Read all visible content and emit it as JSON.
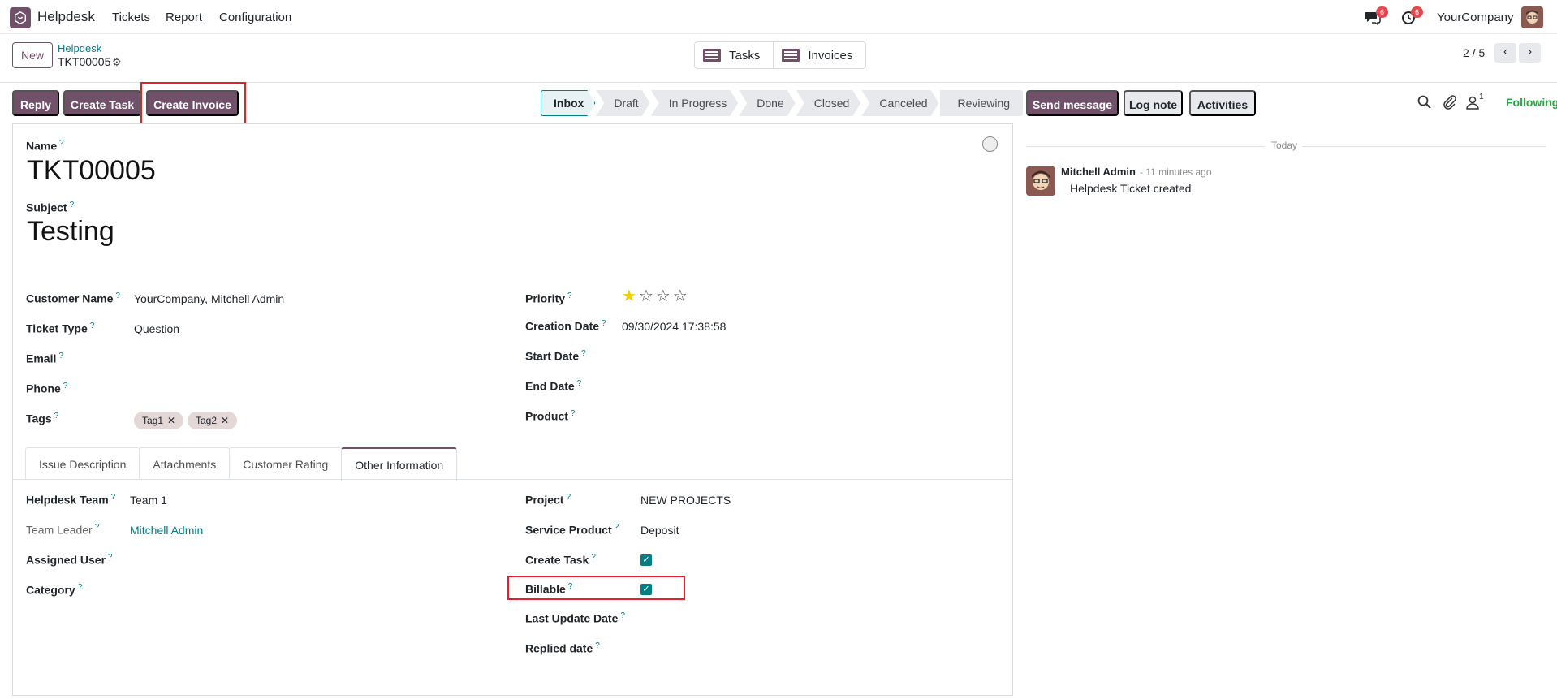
{
  "navbar": {
    "app_name": "Helpdesk",
    "menus": [
      "Tickets",
      "Report",
      "Configuration"
    ],
    "messages_badge": "6",
    "activities_badge": "6",
    "company": "YourCompany"
  },
  "control_panel": {
    "new_label": "New",
    "breadcrumb_parent": "Helpdesk",
    "breadcrumb_current": "TKT00005",
    "smart_buttons": [
      "Tasks",
      "Invoices"
    ],
    "pager": "2 / 5"
  },
  "actions": {
    "reply": "Reply",
    "create_task": "Create Task",
    "create_invoice": "Create Invoice"
  },
  "stages": [
    "Inbox",
    "Draft",
    "In Progress",
    "Done",
    "Closed",
    "Canceled",
    "Reviewing"
  ],
  "active_stage": "Inbox",
  "form": {
    "name_label": "Name",
    "name": "TKT00005",
    "subject_label": "Subject",
    "subject": "Testing",
    "left_fields": [
      {
        "label": "Customer Name",
        "value": "YourCompany, Mitchell Admin"
      },
      {
        "label": "Ticket Type",
        "value": "Question"
      },
      {
        "label": "Email",
        "value": ""
      },
      {
        "label": "Phone",
        "value": ""
      },
      {
        "label": "Tags",
        "value": ""
      }
    ],
    "tags": [
      "Tag1",
      "Tag2"
    ],
    "right_fields": [
      {
        "label": "Priority",
        "value": ""
      },
      {
        "label": "Creation Date",
        "value": "09/30/2024 17:38:58"
      },
      {
        "label": "Start Date",
        "value": ""
      },
      {
        "label": "End Date",
        "value": ""
      },
      {
        "label": "Product",
        "value": ""
      }
    ],
    "priority_stars": 1,
    "priority_max": 4,
    "tabs": [
      "Issue Description",
      "Attachments",
      "Customer Rating",
      "Other Information"
    ],
    "active_tab": "Other Information",
    "other_left": [
      {
        "label": "Helpdesk Team",
        "value": "Team 1"
      },
      {
        "label": "Team Leader",
        "value": "Mitchell Admin"
      },
      {
        "label": "Assigned User",
        "value": ""
      },
      {
        "label": "Category",
        "value": ""
      }
    ],
    "other_right": [
      {
        "label": "Project",
        "value": "NEW PROJECTS"
      },
      {
        "label": "Service Product",
        "value": "Deposit"
      },
      {
        "label": "Create Task",
        "value": ""
      },
      {
        "label": "Billable",
        "value": ""
      },
      {
        "label": "Last Update Date",
        "value": ""
      },
      {
        "label": "Replied date",
        "value": ""
      }
    ],
    "create_task_checked": true,
    "billable_checked": true,
    "help_mark": "?"
  },
  "chatter": {
    "send_message": "Send message",
    "log_note": "Log note",
    "activities": "Activities",
    "followers_count": "1",
    "following": "Following",
    "date_separator": "Today",
    "message": {
      "author": "Mitchell Admin",
      "time": "- 11 minutes ago",
      "body": "Helpdesk Ticket created"
    }
  },
  "colors": {
    "brand": "#71506a",
    "link": "#017e84",
    "highlight": "#e0202a",
    "following": "#28a745"
  }
}
